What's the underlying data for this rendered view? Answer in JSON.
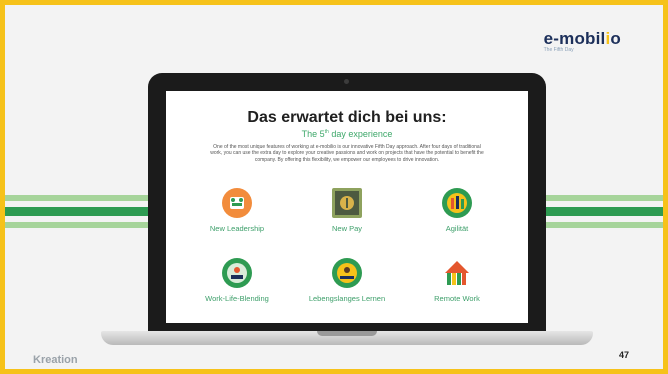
{
  "brand": {
    "logo_main": "e-mobil",
    "logo_accent": "i",
    "logo_end": "o",
    "logo_tagline": "The Fifth Day"
  },
  "slide": {
    "title": "Das erwartet dich bei uns:",
    "subtitle_pre": "The 5",
    "subtitle_sup": "th",
    "subtitle_post": " day experience",
    "body": "One of the most unique features of working at e-mobilio is our innovative Fifth Day approach. After four days of traditional work, you can use the extra day to explore your creative passions and work on projects that have the potential to benefit the company. By offering this flexibility, we empower our employees to drive innovation."
  },
  "features": [
    {
      "label": "New Leadership"
    },
    {
      "label": "New Pay"
    },
    {
      "label": "Agilität"
    },
    {
      "label": "Work-Life-Blending"
    },
    {
      "label": "Lebengslanges Lernen"
    },
    {
      "label": "Remote Work"
    }
  ],
  "footer": {
    "section": "Kreation",
    "page": "47"
  },
  "colors": {
    "frame": "#f6c21a",
    "green": "#2e9b52",
    "light_green": "#a6d49a",
    "navy": "#1c2f5a"
  },
  "icons": [
    "leadership-icon",
    "pay-icon",
    "agility-icon",
    "work-life-icon",
    "learning-icon",
    "remote-work-icon"
  ]
}
